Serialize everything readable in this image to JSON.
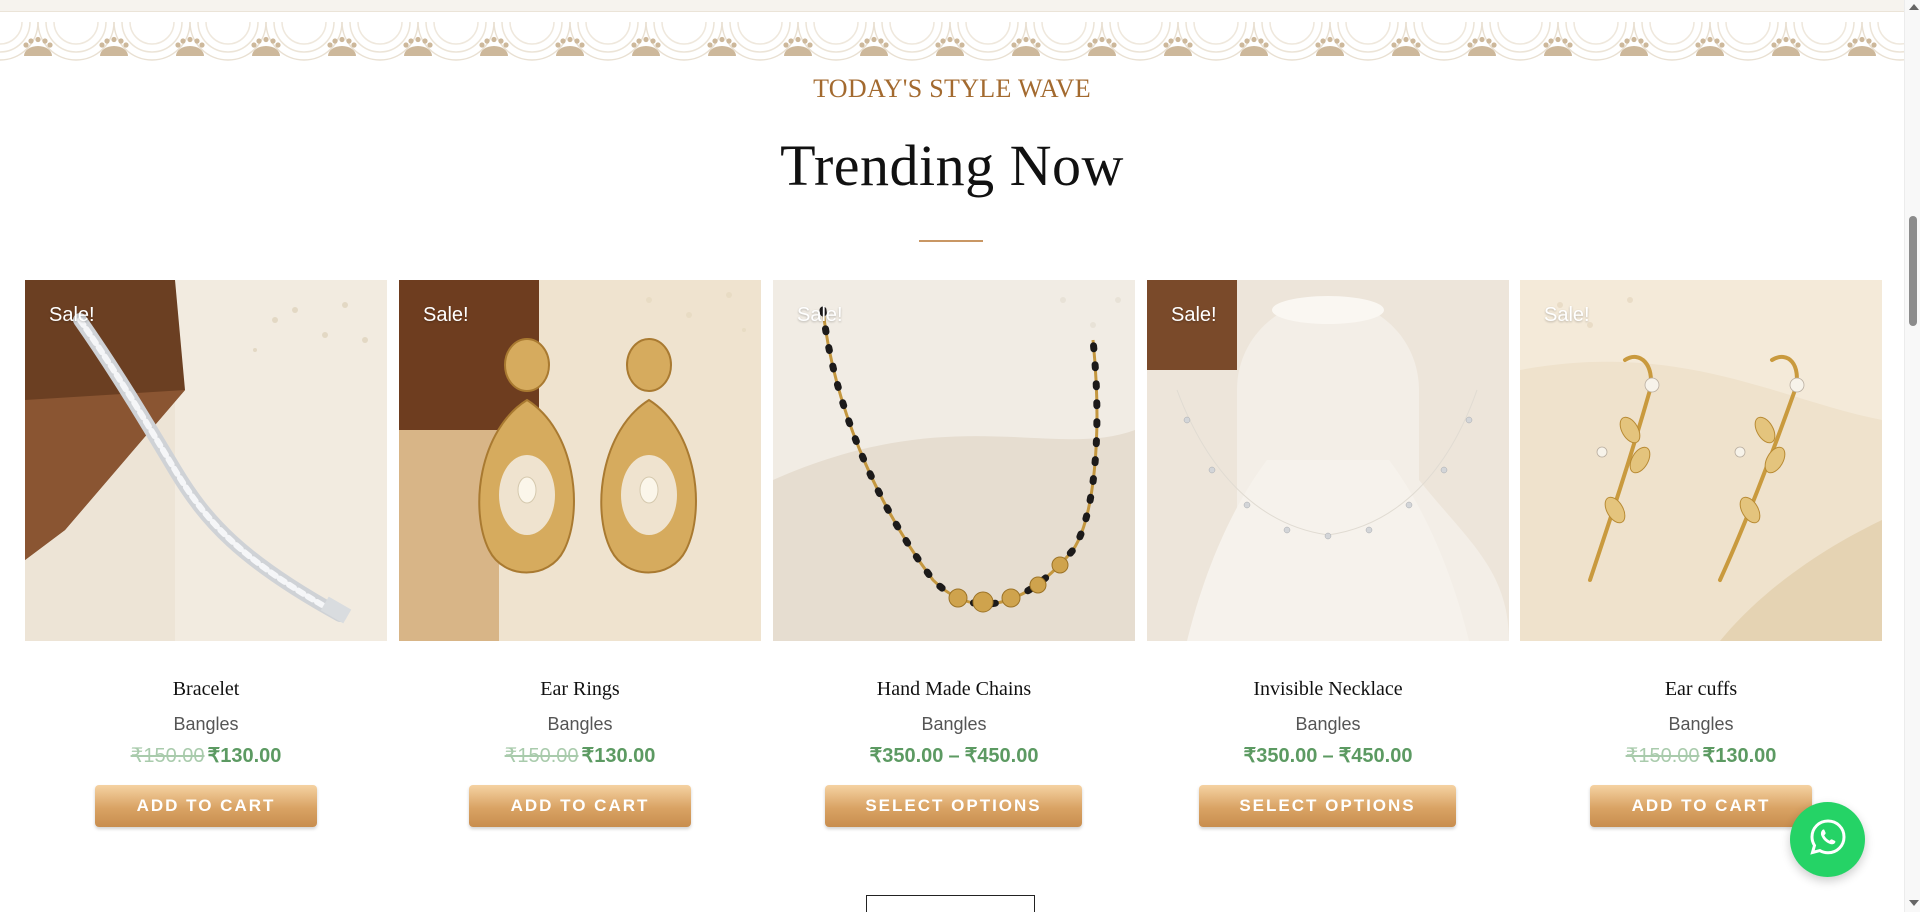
{
  "section": {
    "eyebrow": "TODAY'S STYLE WAVE",
    "title": "Trending Now"
  },
  "products": [
    {
      "name": "Bracelet",
      "category": "Bangles",
      "badge": "Sale!",
      "price_old": "₹150.00",
      "price_new": "₹130.00",
      "button": "ADD TO CART"
    },
    {
      "name": "Ear Rings",
      "category": "Bangles",
      "badge": "Sale!",
      "price_old": "₹150.00",
      "price_new": "₹130.00",
      "button": "ADD TO CART"
    },
    {
      "name": "Hand Made Chains",
      "category": "Bangles",
      "badge": "Sale!",
      "price_min": "₹350.00",
      "price_sep": "–",
      "price_max": "₹450.00",
      "button": "SELECT OPTIONS"
    },
    {
      "name": "Invisible Necklace",
      "category": "Bangles",
      "badge": "Sale!",
      "price_min": "₹350.00",
      "price_sep": "–",
      "price_max": "₹450.00",
      "button": "SELECT OPTIONS"
    },
    {
      "name": "Ear cuffs",
      "category": "Bangles",
      "badge": "Sale!",
      "price_old": "₹150.00",
      "price_new": "₹130.00",
      "button": "ADD TO CART"
    }
  ],
  "icons": {
    "whatsapp": "whatsapp-icon",
    "border": "scallop-border-ornament"
  },
  "colors": {
    "accent_brown": "#a36a2f",
    "price_green": "#5c9a62",
    "button_gold": "#d9a364",
    "whatsapp_green": "#25d366"
  }
}
